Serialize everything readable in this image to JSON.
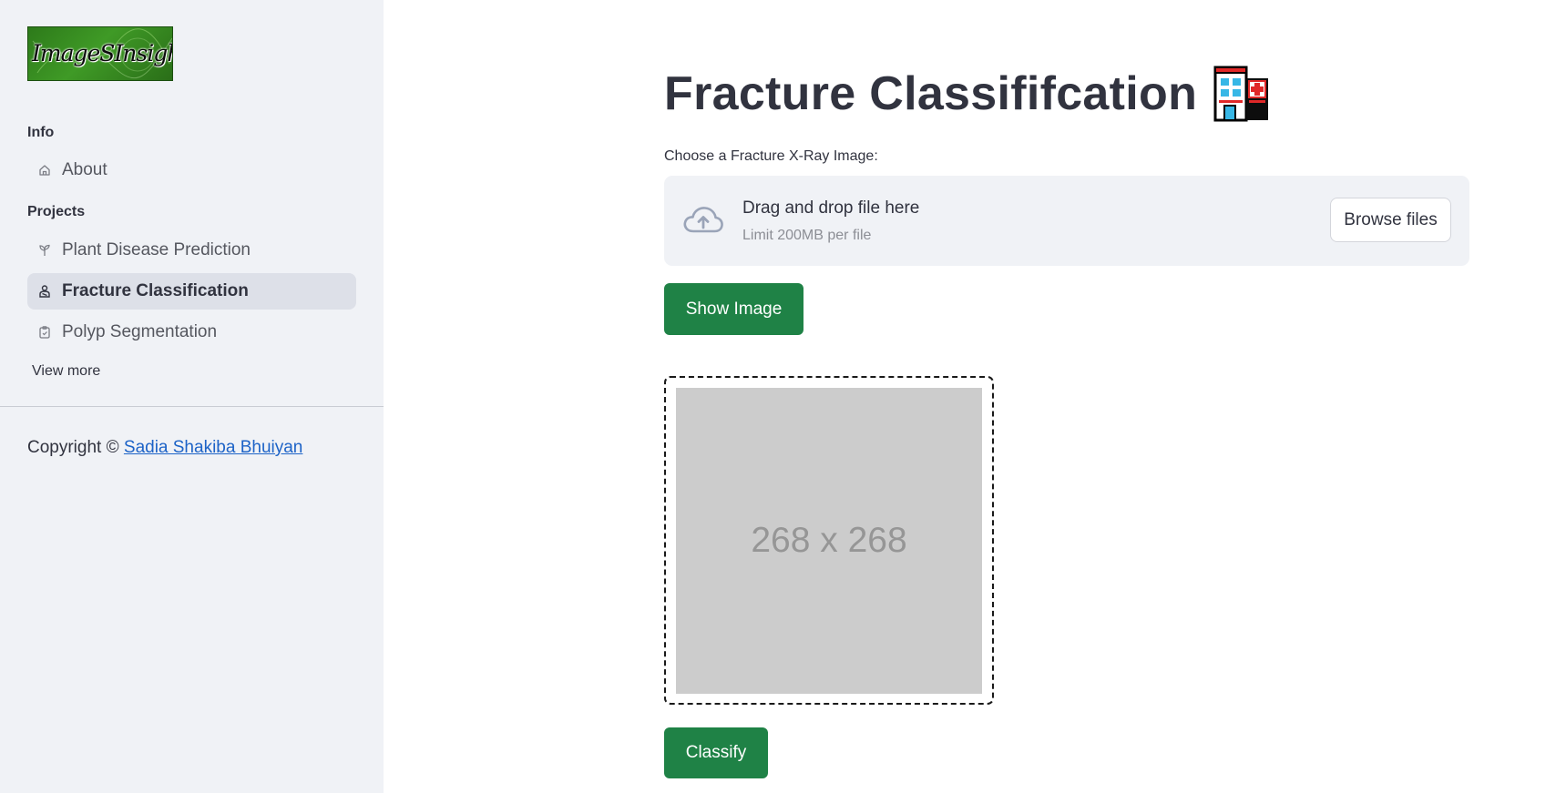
{
  "sidebar": {
    "logo_text": "ImageSInsight",
    "sections": [
      {
        "title": "Info"
      },
      {
        "title": "Projects"
      }
    ],
    "items": [
      {
        "label": "About",
        "icon": "house-icon"
      },
      {
        "label": "Plant Disease Prediction",
        "icon": "plant-icon"
      },
      {
        "label": "Fracture Classification",
        "icon": "person-bandage-icon",
        "active": true
      },
      {
        "label": "Polyp Segmentation",
        "icon": "clipboard-icon"
      }
    ],
    "view_more": "View more",
    "copyright_prefix": "Copyright ©",
    "copyright_author": "Sadia Shakiba Bhuiyan"
  },
  "main": {
    "title": "Fracture Classififcation",
    "title_emoji": "hospital-icon",
    "uploader": {
      "label": "Choose a Fracture X-Ray Image:",
      "drop_text": "Drag and drop file here",
      "limit_text": "Limit 200MB per file",
      "browse_label": "Browse files",
      "icon": "cloud-upload-icon"
    },
    "show_button": "Show Image",
    "image_placeholder": "268 x 268",
    "classify_button": "Classify"
  },
  "colors": {
    "sidebar_bg": "#f0f2f6",
    "accent_green": "#1f8246",
    "link_blue": "#1d63c7",
    "active_item_bg": "#dde0e8"
  }
}
